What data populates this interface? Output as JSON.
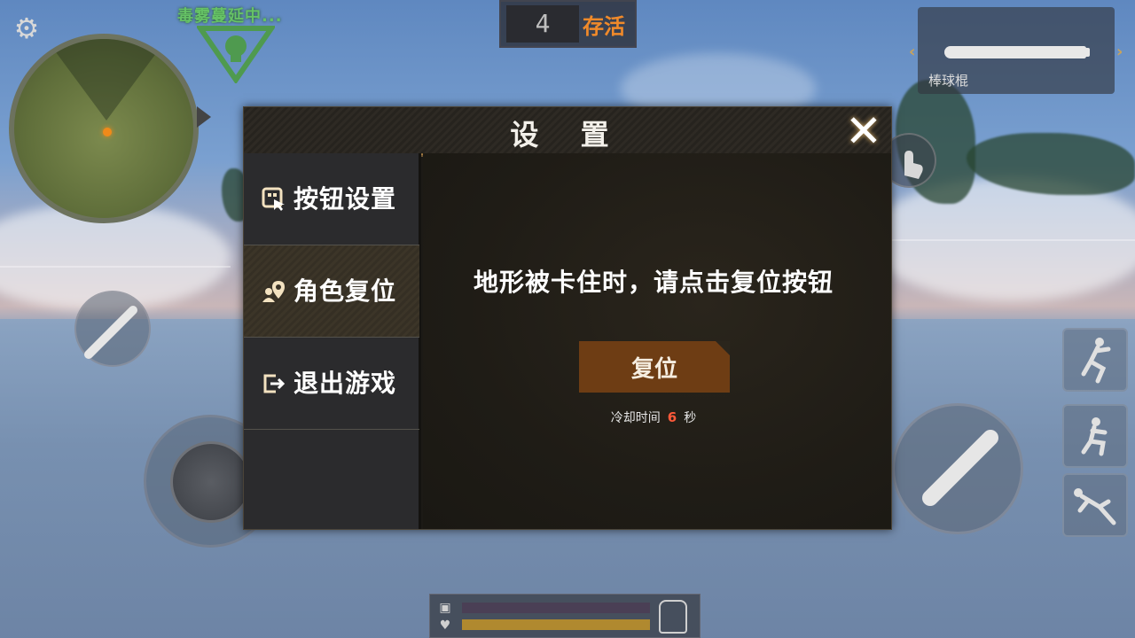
{
  "hud": {
    "settings_icon": "gear-icon",
    "poison_status": "毒雾蔓延中...",
    "survivors": {
      "count": "4",
      "label": "存活"
    },
    "weapon": {
      "name": "棒球棍",
      "icon": "baseball-bat-icon"
    },
    "colors": {
      "poison": "#66c266",
      "survivor_label": "#f08a2a",
      "accent": "#6e3d14",
      "cooldown_number": "#ff5a3a"
    }
  },
  "dialog": {
    "title": "设 置",
    "close_icon": "close-icon",
    "sidebar": {
      "items": [
        {
          "label": "按钮设置",
          "icon": "button-settings-icon",
          "active": false
        },
        {
          "label": "角色复位",
          "icon": "character-reset-icon",
          "active": true
        },
        {
          "label": "退出游戏",
          "icon": "exit-icon",
          "active": false
        }
      ]
    },
    "content": {
      "message": "地形被卡住时，请点击复位按钮",
      "reset_button": "复位",
      "cooldown_label": "冷却时间",
      "cooldown_value": "6",
      "cooldown_unit": "秒"
    }
  }
}
